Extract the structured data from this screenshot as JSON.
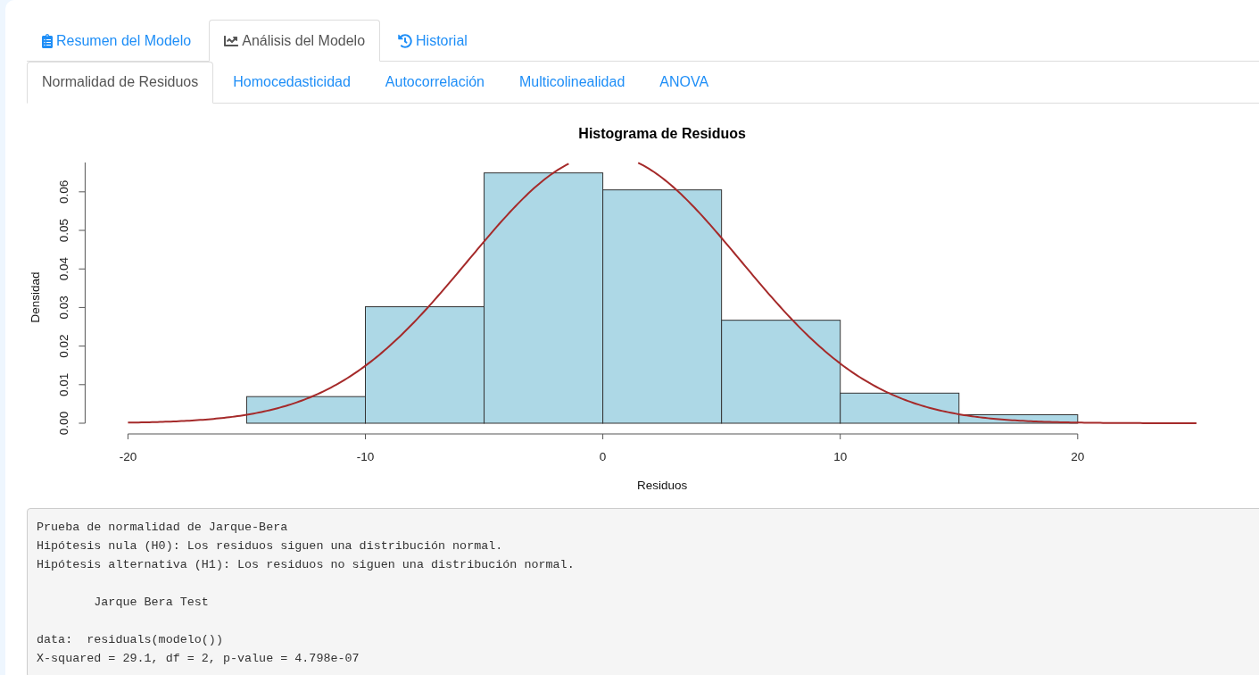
{
  "main_tabs": [
    {
      "label": "Resumen del Modelo",
      "kind": "summary",
      "selected": false
    },
    {
      "label": "Análisis del Modelo",
      "kind": "analysis",
      "selected": true
    },
    {
      "label": "Historial",
      "kind": "history",
      "selected": false
    }
  ],
  "sub_tabs": [
    {
      "label": "Normalidad de Residuos",
      "selected": true
    },
    {
      "label": "Homocedasticidad",
      "selected": false
    },
    {
      "label": "Autocorrelación",
      "selected": false
    },
    {
      "label": "Multicolinealidad",
      "selected": false
    },
    {
      "label": "ANOVA",
      "selected": false
    }
  ],
  "histogram": {
    "chart_data": {
      "type": "bar",
      "title": "Histograma de Residuos",
      "xlabel": "Residuos",
      "ylabel": "Densidad",
      "x": [
        -17.5,
        -12.5,
        -7.5,
        -2.5,
        2.5,
        7.5,
        12.5,
        17.5
      ],
      "values": [
        0,
        0.0069,
        0.0302,
        0.0649,
        0.0605,
        0.0267,
        0.0078,
        0.0022
      ],
      "xlim": [
        -20,
        20
      ],
      "ylim": [
        0,
        0.0676
      ],
      "xticks": [
        -20,
        -10,
        0,
        10,
        20
      ],
      "yticks": [
        {
          "value": 0,
          "label": "0.00"
        },
        {
          "value": 0.01,
          "label": "0.01"
        },
        {
          "value": 0.02,
          "label": "0.02"
        },
        {
          "value": 0.03,
          "label": "0.03"
        },
        {
          "value": 0.04,
          "label": "0.04"
        },
        {
          "value": 0.05,
          "label": "0.05"
        },
        {
          "value": 0.06,
          "label": "0.06"
        }
      ]
    }
  },
  "test_output": {
    "text": "Prueba de normalidad de Jarque-Bera\nHipótesis nula (H0): Los residuos siguen una distribución normal.\nHipótesis alternativa (H1): Los residuos no siguen una distribución normal.\n\n        Jarque Bera Test\n\ndata:  residuals(modelo())\nX-squared = 29.1, df = 2, p-value = 4.798e-07"
  }
}
